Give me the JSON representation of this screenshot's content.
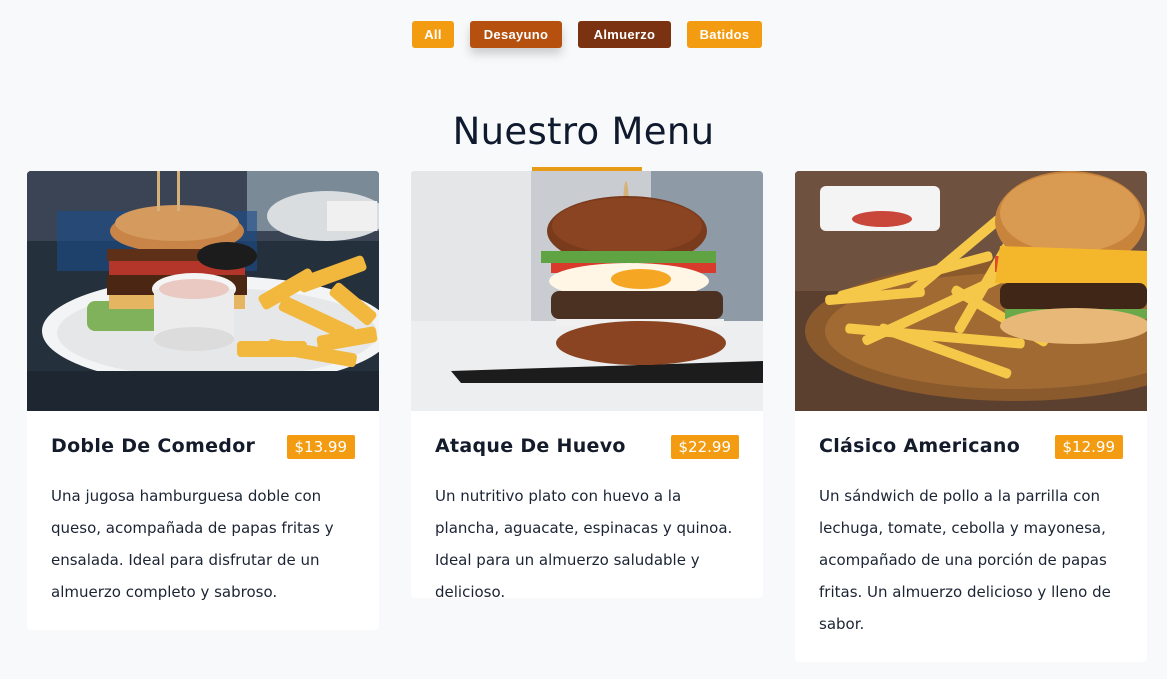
{
  "filters": [
    {
      "label": "All",
      "color": "#f39c12"
    },
    {
      "label": "Desayuno",
      "color": "#b5500f"
    },
    {
      "label": "Almuerzo",
      "color": "#7a3211"
    },
    {
      "label": "Batidos",
      "color": "#f39c12"
    }
  ],
  "section": {
    "title": "Nuestro Menu"
  },
  "menu_items": [
    {
      "name": "Doble De Comedor",
      "price": "$13.99",
      "description": "Una jugosa hamburguesa doble con queso, acompañada de papas fritas y ensalada. Ideal para disfrutar de un almuerzo completo y sabroso."
    },
    {
      "name": "Ataque De Huevo",
      "price": "$22.99",
      "description": "Un nutritivo plato con huevo a la plancha, aguacate, espinacas y quinoa. Ideal para un almuerzo saludable y delicioso."
    },
    {
      "name": "Clásico Americano",
      "price": "$12.99",
      "description": "Un sándwich de pollo a la parrilla con lechuga, tomate, cebolla y mayonesa, acompañado de una porción de papas fritas. Un almuerzo delicioso y lleno de sabor."
    }
  ],
  "colors": {
    "accent": "#f39c12",
    "active_filter": "#7a3211",
    "title_underline": "#e79b17"
  }
}
